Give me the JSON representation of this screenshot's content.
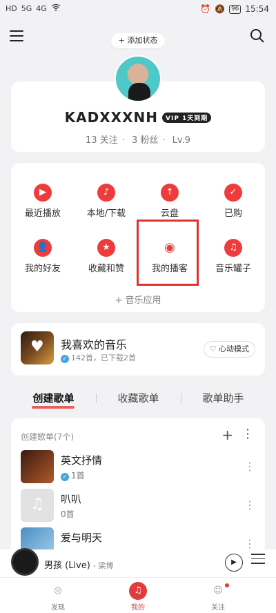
{
  "status_bar": {
    "left": [
      "HD",
      "5G",
      "4G"
    ],
    "battery": "96",
    "time": "15:54"
  },
  "top": {
    "add_status": "+ 添加状态"
  },
  "profile": {
    "username": "KADXXXNH",
    "vip_badge": "VIP 1天到期",
    "following": "13 关注",
    "fans": "3 粉丝",
    "level": "Lv.9"
  },
  "functions": [
    {
      "label": "最近播放",
      "icon": "play-icon",
      "glyph": "▶"
    },
    {
      "label": "本地/下载",
      "icon": "music-note-icon",
      "glyph": "♪"
    },
    {
      "label": "云盘",
      "icon": "cloud-upload-icon",
      "glyph": "↑"
    },
    {
      "label": "已购",
      "icon": "shopping-bag-icon",
      "glyph": "✓"
    },
    {
      "label": "我的好友",
      "icon": "friends-icon",
      "glyph": "👤"
    },
    {
      "label": "收藏和赞",
      "icon": "star-icon",
      "glyph": "★"
    },
    {
      "label": "我的播客",
      "icon": "broadcast-icon",
      "glyph": "◉"
    },
    {
      "label": "音乐罐子",
      "icon": "music-jar-icon",
      "glyph": "♫"
    }
  ],
  "music_apps": "+ 音乐应用",
  "favorites": {
    "title": "我喜欢的音乐",
    "subtitle": "142首，已下载2首",
    "heart_mode": "心动模式"
  },
  "tabs": [
    "创建歌单",
    "收藏歌单",
    "歌单助手"
  ],
  "playlists": {
    "header": "创建歌单(7个)",
    "items": [
      {
        "name": "英文抒情",
        "count": "1首",
        "color": "#8a4a2a"
      },
      {
        "name": "叭叭",
        "count": "0首",
        "color": "#d9d9d9"
      },
      {
        "name": "爱与明天",
        "count": "",
        "color": "#6aa9d6"
      }
    ]
  },
  "player": {
    "title": "男孩 (Live)",
    "artist": "- 梁博"
  },
  "nav": [
    {
      "label": "发现",
      "icon": "discover-icon"
    },
    {
      "label": "我的",
      "icon": "my-music-icon"
    },
    {
      "label": "关注",
      "icon": "follow-icon"
    }
  ],
  "accent_color": "#e23b3b"
}
